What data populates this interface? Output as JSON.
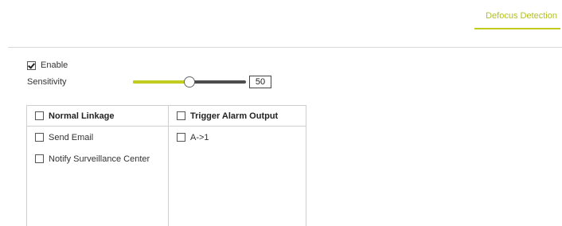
{
  "tabs": [
    {
      "label": "Defocus Detection",
      "active": true
    }
  ],
  "accent_color": "#c2cc1f",
  "enable": {
    "label": "Enable",
    "checked": true
  },
  "sensitivity": {
    "label": "Sensitivity",
    "value": "50",
    "level": 0.5
  },
  "linkage": {
    "normal": {
      "header": "Normal Linkage",
      "header_checked": false,
      "items": [
        {
          "label": "Send Email",
          "checked": false
        },
        {
          "label": "Notify Surveillance Center",
          "checked": false
        }
      ]
    },
    "alarm": {
      "header": "Trigger Alarm Output",
      "header_checked": false,
      "items": [
        {
          "label": "A->1",
          "checked": false
        }
      ]
    }
  }
}
